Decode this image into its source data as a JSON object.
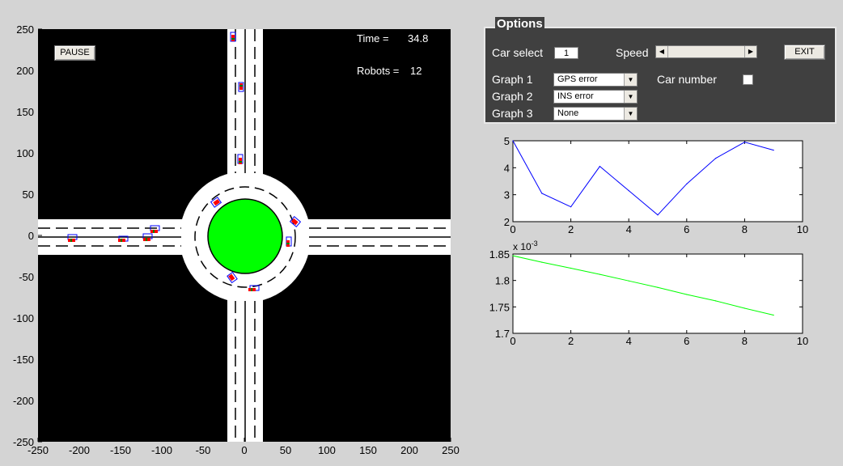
{
  "simulation": {
    "pause_label": "PAUSE",
    "time_label": "Time =",
    "time_value": "34.8",
    "robots_label": "Robots =",
    "robots_value": "12",
    "xticks": [
      "-250",
      "-200",
      "-150",
      "-100",
      "-50",
      "0",
      "50",
      "100",
      "150",
      "200",
      "250"
    ],
    "yticks": [
      "250",
      "200",
      "150",
      "100",
      "50",
      "0",
      "-50",
      "-100",
      "-150",
      "-200",
      "-250"
    ],
    "colors": {
      "background": "#000000",
      "road": "#ffffff",
      "island": "#00ff00",
      "car": "#ff0000",
      "car_outline": "#0000ff"
    }
  },
  "options": {
    "title": "Options",
    "car_select_label": "Car select",
    "car_select_value": "1",
    "speed_label": "Speed",
    "exit_label": "EXIT",
    "graph1_label": "Graph 1",
    "graph1_value": "GPS error",
    "graph2_label": "Graph 2",
    "graph2_value": "INS error",
    "graph3_label": "Graph 3",
    "graph3_value": "None",
    "car_number_label": "Car number",
    "car_number_checked": false,
    "panel_color": "#404040"
  },
  "chart_data": [
    {
      "type": "line",
      "x": [
        0,
        1,
        2,
        3,
        4,
        5,
        6,
        7,
        8,
        9
      ],
      "y": [
        5.0,
        3.05,
        2.55,
        4.05,
        3.15,
        2.25,
        3.4,
        4.35,
        4.95,
        4.65
      ],
      "xlim": [
        0,
        10
      ],
      "ylim": [
        2,
        5
      ],
      "xticks": [
        "0",
        "2",
        "4",
        "6",
        "8",
        "10"
      ],
      "yticks": [
        "5",
        "4",
        "3",
        "2"
      ],
      "color": "#0000ff"
    },
    {
      "type": "line",
      "x": [
        0,
        1,
        2,
        3,
        4,
        5,
        6,
        7,
        8,
        9
      ],
      "y": [
        1.8468,
        1.8345,
        1.8232,
        1.8115,
        1.7992,
        1.7868,
        1.7735,
        1.7614,
        1.7474,
        1.7345
      ],
      "xlim": [
        0,
        10
      ],
      "ylim": [
        1.7,
        1.85
      ],
      "xticks": [
        "0",
        "2",
        "4",
        "6",
        "8",
        "10"
      ],
      "yticks": [
        "1.85",
        "1.8",
        "1.75",
        "1.7"
      ],
      "exponent_base": "x 10",
      "exponent_power": "-3",
      "color": "#00ff00"
    }
  ]
}
